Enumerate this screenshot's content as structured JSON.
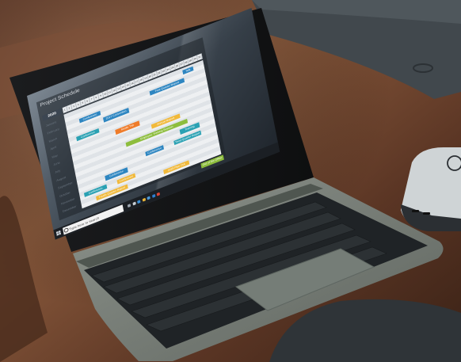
{
  "schedule": {
    "title": "Project Schedule",
    "year": "2020",
    "days": [
      "1",
      "2",
      "3",
      "4",
      "5",
      "6",
      "7",
      "8",
      "9",
      "10",
      "11",
      "12",
      "13",
      "14",
      "15",
      "16",
      "17",
      "18",
      "19",
      "20",
      "21",
      "22",
      "23",
      "24",
      "25",
      "26",
      "27",
      "28",
      "29",
      "30",
      "31"
    ],
    "months": [
      "January",
      "February",
      "March",
      "April",
      "May",
      "June",
      "July",
      "August",
      "September",
      "October",
      "November",
      "December"
    ],
    "bars": [
      {
        "label": "Conference",
        "color": "#2e86c1"
      },
      {
        "label": "2017 Convention",
        "color": "#2e86c1"
      },
      {
        "label": "First Quarter Report",
        "color": "#2e86c1"
      },
      {
        "label": "Talk",
        "color": "#2e86c1"
      },
      {
        "label": "Conference",
        "color": "#2aa1b3"
      },
      {
        "label": "Media Trip",
        "color": "#ef7c2a"
      },
      {
        "label": "Annual Report",
        "color": "#f1b93a"
      },
      {
        "label": "Employee Training Session",
        "color": "#8dbd3d"
      },
      {
        "label": "Training",
        "color": "#2aa1b3"
      },
      {
        "label": "Conference",
        "color": "#2e86c1"
      },
      {
        "label": "Conference",
        "color": "#2e86c1"
      },
      {
        "label": "Third Quarter Report",
        "color": "#2aa1b3"
      },
      {
        "label": "Conference",
        "color": "#2aa1b3"
      },
      {
        "label": "Conference",
        "color": "#f1b93a"
      },
      {
        "label": "2018 Plan Out",
        "color": "#f1b93a"
      },
      {
        "label": "Out of the Office",
        "color": "#8dbd3d"
      },
      {
        "label": "Fourth Quarter Report",
        "color": "#f1b93a"
      }
    ]
  },
  "taskbar": {
    "search_placeholder": "Type here to search",
    "icons": [
      "start-icon",
      "search-icon",
      "task-view-icon",
      "edge-icon",
      "file-explorer-icon",
      "store-icon",
      "mail-icon",
      "chrome-icon",
      "app-icon"
    ]
  },
  "hardware": {
    "logo_device": "dell-logo",
    "logo_charger": "dell-logo"
  }
}
